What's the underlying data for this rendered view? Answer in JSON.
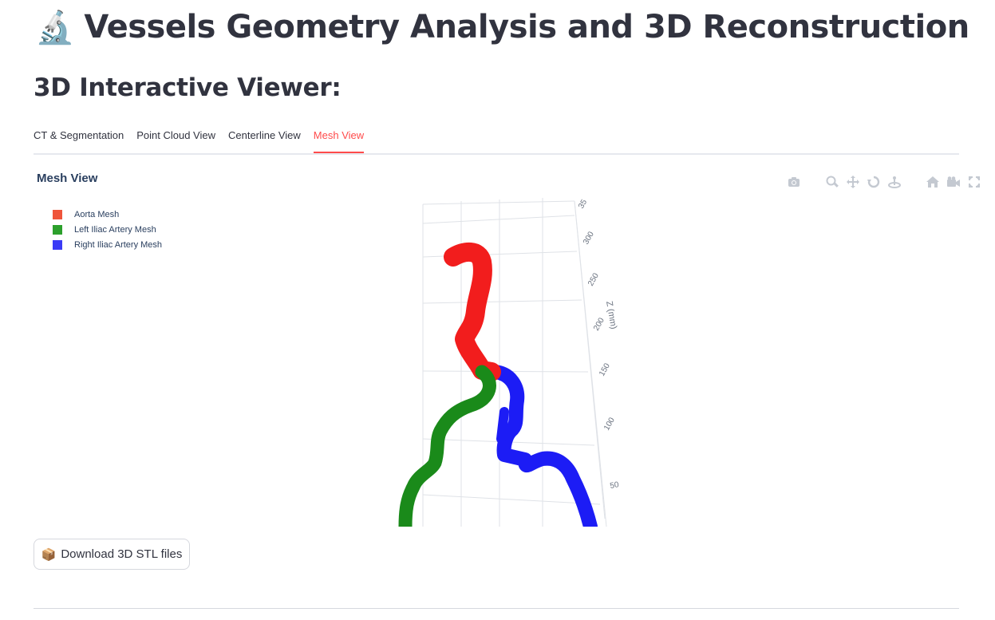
{
  "header": {
    "emoji": "🔬",
    "title": "Vessels Geometry Analysis and 3D Reconstruction"
  },
  "section": {
    "title": "3D Interactive Viewer:"
  },
  "tabs": [
    {
      "label": "CT & Segmentation",
      "active": false
    },
    {
      "label": "Point Cloud View",
      "active": false
    },
    {
      "label": "Centerline View",
      "active": false
    },
    {
      "label": "Mesh View",
      "active": true
    }
  ],
  "accent_color": "#ff4b4b",
  "plot": {
    "title": "Mesh View",
    "modebar_icons": [
      "camera-icon",
      "zoom-icon",
      "pan-icon",
      "orbit-rotate-icon",
      "turntable-rotate-icon",
      "home-icon",
      "camera-reset-icon",
      "fullscreen-icon"
    ],
    "legend": [
      {
        "label": "Aorta Mesh",
        "color": "#ef553b"
      },
      {
        "label": "Left Iliac Artery Mesh",
        "color": "#2ca02c"
      },
      {
        "label": "Right Iliac Artery Mesh",
        "color": "#3b3bf6"
      }
    ],
    "z_axis": {
      "title": "Z (mm)",
      "ticks": [
        "35",
        "300",
        "250",
        "200",
        "150",
        "100",
        "50"
      ]
    }
  },
  "download": {
    "emoji": "📦",
    "label": "Download 3D STL files"
  }
}
